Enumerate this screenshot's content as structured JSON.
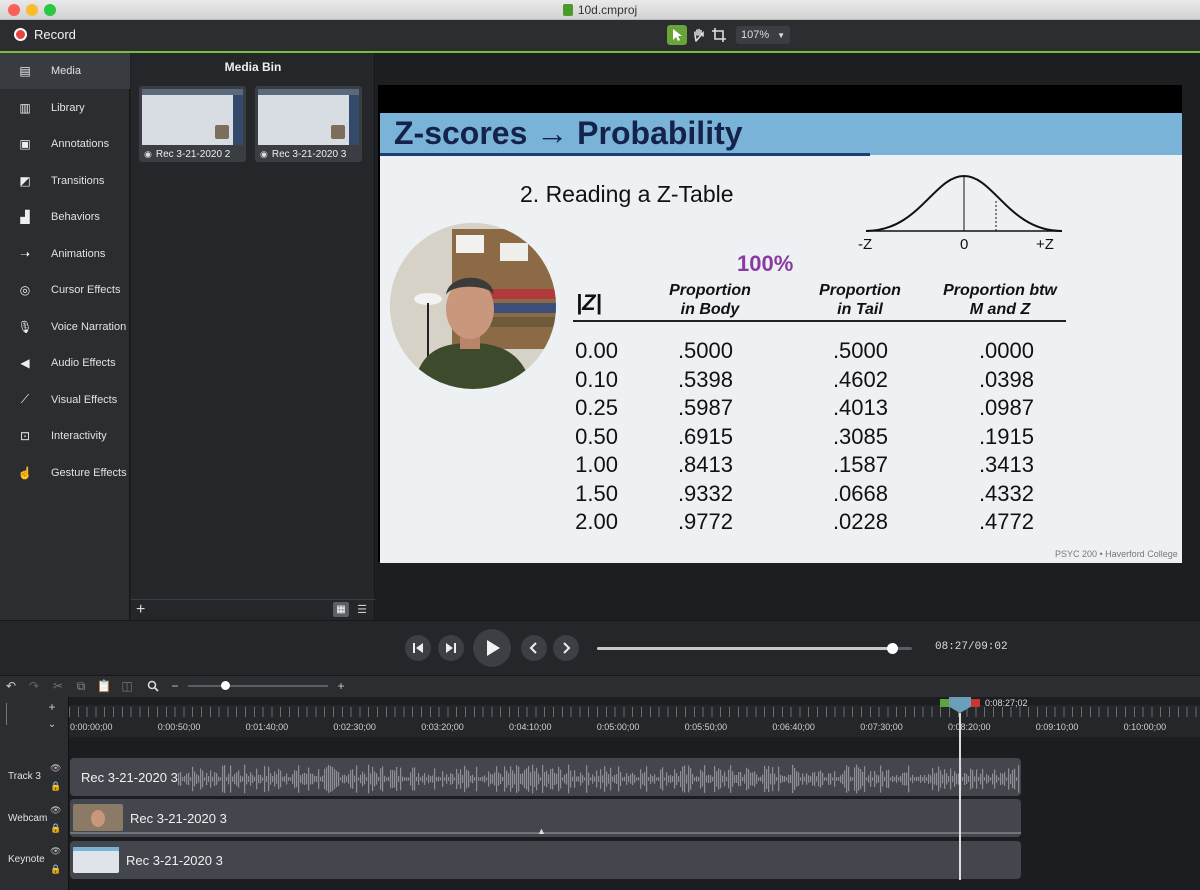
{
  "window": {
    "title": "10d.cmproj",
    "traffic_lights": [
      "#fc5f57",
      "#fdbc2e",
      "#28c840"
    ]
  },
  "toolbar": {
    "record_label": "Record",
    "zoom_value": "107%",
    "tools": [
      "select-arrow-icon",
      "hand-pan-icon",
      "crop-icon"
    ],
    "accent_color": "#7dbb3c"
  },
  "sidebar": {
    "items": [
      {
        "label": "Media",
        "icon": "film-strip-icon",
        "active": true
      },
      {
        "label": "Library",
        "icon": "books-icon"
      },
      {
        "label": "Annotations",
        "icon": "callout-icon"
      },
      {
        "label": "Transitions",
        "icon": "transition-icon"
      },
      {
        "label": "Behaviors",
        "icon": "behaviors-icon"
      },
      {
        "label": "Animations",
        "icon": "arrow-animation-icon"
      },
      {
        "label": "Cursor Effects",
        "icon": "cursor-icon"
      },
      {
        "label": "Voice Narration",
        "icon": "microphone-icon"
      },
      {
        "label": "Audio Effects",
        "icon": "speaker-icon"
      },
      {
        "label": "Visual Effects",
        "icon": "magic-wand-icon"
      },
      {
        "label": "Interactivity",
        "icon": "interactivity-icon"
      },
      {
        "label": "Gesture Effects",
        "icon": "hand-gesture-icon"
      }
    ]
  },
  "media_bin": {
    "title": "Media Bin",
    "items": [
      {
        "label": "Rec 3-21-2020 2"
      },
      {
        "label": "Rec 3-21-2020 3"
      }
    ],
    "add_label": "+"
  },
  "slide": {
    "title": "Z-scores → Probability",
    "subtitle": "2. Reading a Z-Table",
    "percent": "100%",
    "curve_labels": [
      "-Z",
      "0",
      "+Z"
    ],
    "headers": {
      "z": "|Z|",
      "body": [
        "Proportion",
        "in Body"
      ],
      "tail": [
        "Proportion",
        "in Tail"
      ],
      "btw": [
        "Proportion btw",
        "M and Z"
      ]
    },
    "rows": [
      [
        "0.00",
        ".5000",
        ".5000",
        ".0000"
      ],
      [
        "0.10",
        ".5398",
        ".4602",
        ".0398"
      ],
      [
        "0.25",
        ".5987",
        ".4013",
        ".0987"
      ],
      [
        "0.50",
        ".6915",
        ".3085",
        ".1915"
      ],
      [
        "1.00",
        ".8413",
        ".1587",
        ".3413"
      ],
      [
        "1.50",
        ".9332",
        ".0668",
        ".4332"
      ],
      [
        "2.00",
        ".9772",
        ".0228",
        ".4772"
      ]
    ],
    "footer": "PSYC 200 • Haverford College",
    "header_color": "#7ab3d8",
    "title_color": "#15224a",
    "percent_color": "#8a3aa0"
  },
  "playback": {
    "timecode": "08:27/09:02",
    "progress": 0.935
  },
  "timeline": {
    "playhead_time": "0:08:27;02",
    "ruler_labels": [
      "0:00:00;00",
      "0:00:50;00",
      "0:01:40;00",
      "0:02:30;00",
      "0:03:20;00",
      "0:04:10;00",
      "0:05:00;00",
      "0:05:50;00",
      "0:06:40;00",
      "0:07:30;00",
      "0:08:20;00",
      "0:09:10;00",
      "0:10:00;00"
    ],
    "tracks": [
      {
        "name": "Track 3",
        "clip": "Rec 3-21-2020 3",
        "kind": "audio"
      },
      {
        "name": "Webcam",
        "clip": "Rec 3-21-2020 3",
        "kind": "video"
      },
      {
        "name": "Keynote",
        "clip": "Rec 3-21-2020 3",
        "kind": "video"
      }
    ]
  }
}
